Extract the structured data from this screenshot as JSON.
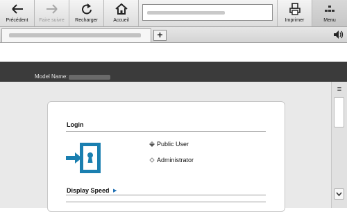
{
  "toolbar": {
    "back_label": "Précédent",
    "forward_label": "Faire suivre",
    "reload_label": "Recharger",
    "home_label": "Accueil",
    "print_label": "Imprimer",
    "menu_label": "Menu"
  },
  "header": {
    "model_label": "Model Name:"
  },
  "login": {
    "title": "Login",
    "options": [
      {
        "label": "Public User"
      },
      {
        "label": "Administrator"
      }
    ]
  },
  "display_speed": {
    "title": "Display Speed"
  },
  "icons": {
    "login": "door-enter-icon",
    "accent_color": "#1a7fb0"
  }
}
